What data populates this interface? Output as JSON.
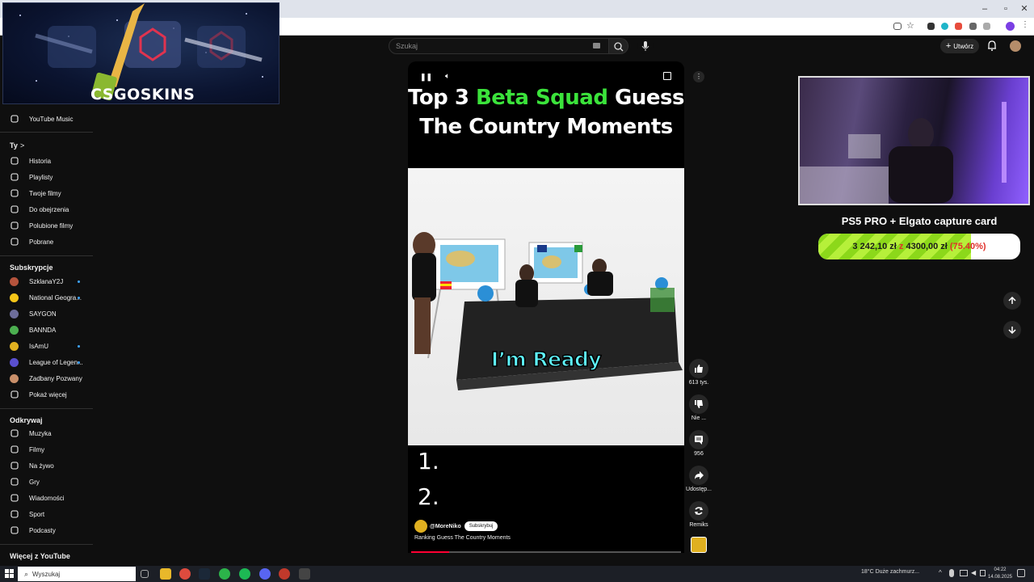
{
  "overlay_banner": {
    "brand": "CSGOSKINS"
  },
  "search": {
    "placeholder": "Szukaj"
  },
  "header": {
    "create_label": "Utwórz"
  },
  "sidebar": {
    "top_items": [
      {
        "label": "YouTube Music",
        "icon": "youtube-music-icon"
      }
    ],
    "you_section": {
      "title": "Ty",
      "chevron": ">"
    },
    "you_items": [
      {
        "label": "Historia",
        "icon": "history-icon"
      },
      {
        "label": "Playlisty",
        "icon": "playlist-icon"
      },
      {
        "label": "Twoje filmy",
        "icon": "your-videos-icon"
      },
      {
        "label": "Do obejrzenia",
        "icon": "watch-later-icon"
      },
      {
        "label": "Polubione filmy",
        "icon": "liked-icon"
      },
      {
        "label": "Pobrane",
        "icon": "download-icon"
      }
    ],
    "subscriptions_title": "Subskrypcje",
    "subscriptions": [
      {
        "label": "SzklanaY2J",
        "color": "#b5533c",
        "new": true
      },
      {
        "label": "National Geogra...",
        "color": "#f5c518",
        "new": true
      },
      {
        "label": "SAYGON",
        "color": "#6d6d9a",
        "new": false
      },
      {
        "label": "BANNDA",
        "color": "#4caf50",
        "new": false
      },
      {
        "label": "IsAmU",
        "color": "#e0b020",
        "new": true
      },
      {
        "label": "League of Legen...",
        "color": "#5a4fcf",
        "new": true
      },
      {
        "label": "Zadbany Pozwany",
        "color": "#c98f6a",
        "new": false
      }
    ],
    "show_more": "Pokaż więcej",
    "explore_title": "Odkrywaj",
    "explore_items": [
      {
        "label": "Muzyka",
        "icon": "music-icon"
      },
      {
        "label": "Filmy",
        "icon": "movies-icon"
      },
      {
        "label": "Na żywo",
        "icon": "live-icon"
      },
      {
        "label": "Gry",
        "icon": "gaming-icon"
      },
      {
        "label": "Wiadomości",
        "icon": "news-icon"
      },
      {
        "label": "Sport",
        "icon": "sport-icon"
      },
      {
        "label": "Podcasty",
        "icon": "podcast-icon"
      }
    ],
    "more_title": "Więcej z YouTube"
  },
  "short": {
    "title_part1": "Top 3 ",
    "title_highlight": "Beta Squad",
    "title_part2": " Guess The Country Moments",
    "caption": "I’m Ready",
    "rank1": "1.",
    "rank2": "2.",
    "channel": "@MoreNiko",
    "subscribe_label": "Subskrybuj",
    "description": "Ranking Guess The Country Moments",
    "progress": 0.14
  },
  "actions": {
    "likes": "613 tys.",
    "dislike": "Nie ...",
    "comments": "956",
    "share": "Udostęp...",
    "remix": "Remiks"
  },
  "stream_goal": {
    "title": "PS5 PRO + Elgato capture card",
    "current": "3 242,10 zł",
    "separator": "z",
    "target": "4300,00 zł",
    "percent_text": "(75.40%)",
    "fraction": 0.754,
    "accent_red": "#e0302a"
  },
  "taskbar": {
    "search_placeholder": "Wyszukaj",
    "weather": "18°C  Duże zachmurz...",
    "time": "04:22",
    "date": "14.08.2025"
  }
}
